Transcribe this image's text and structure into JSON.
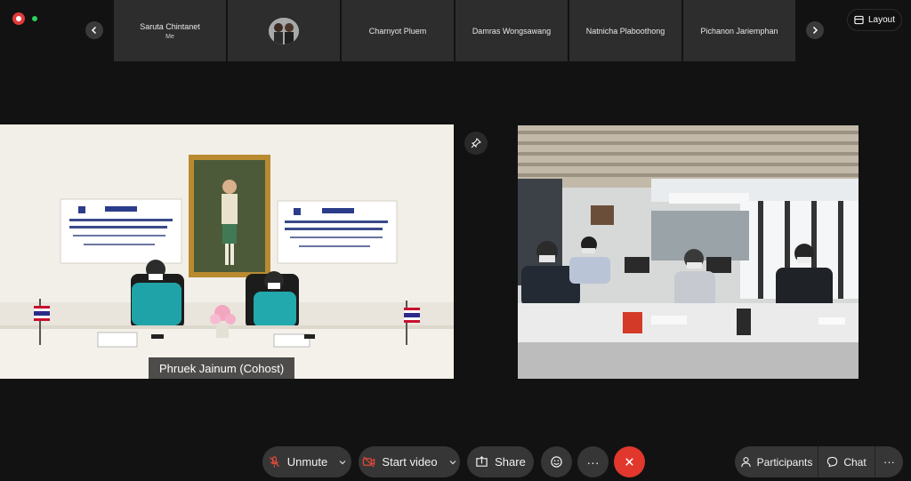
{
  "gallery": {
    "participants": [
      {
        "name": "Saruta Chintanet",
        "sub": "Me"
      },
      {
        "name": "",
        "sub": ""
      },
      {
        "name": "Charnyot Pluem",
        "sub": ""
      },
      {
        "name": "Damras Wongsawang",
        "sub": ""
      },
      {
        "name": "Natnicha Plaboothong",
        "sub": ""
      },
      {
        "name": "Pichanon Jariemphan",
        "sub": ""
      }
    ]
  },
  "layout_button": {
    "label": "Layout"
  },
  "main": {
    "active_speaker_name": "Phruek Jainum (Cohost)"
  },
  "toolbar": {
    "unmute_label": "Unmute",
    "start_video_label": "Start video",
    "share_label": "Share",
    "more_label": "···",
    "participants_label": "Participants",
    "chat_label": "Chat",
    "overflow_label": "···"
  },
  "colors": {
    "background": "#121212",
    "tile": "#2d2d2d",
    "toolbar_button": "#363636",
    "leave": "#e2372d",
    "record": "#e03a3a",
    "live": "#2fcf5a",
    "mute_icon": "#e24a3b"
  },
  "icons": {
    "record": "record-icon",
    "nav_prev": "chevron-left-icon",
    "nav_next": "chevron-right-icon",
    "layout": "grid-layout-icon",
    "pin": "pin-icon",
    "mic_muted": "microphone-muted-icon",
    "video_off": "video-off-icon",
    "share": "share-screen-icon",
    "reactions": "smiley-icon",
    "leave": "close-icon",
    "participants": "person-icon",
    "chat": "chat-bubble-icon"
  }
}
